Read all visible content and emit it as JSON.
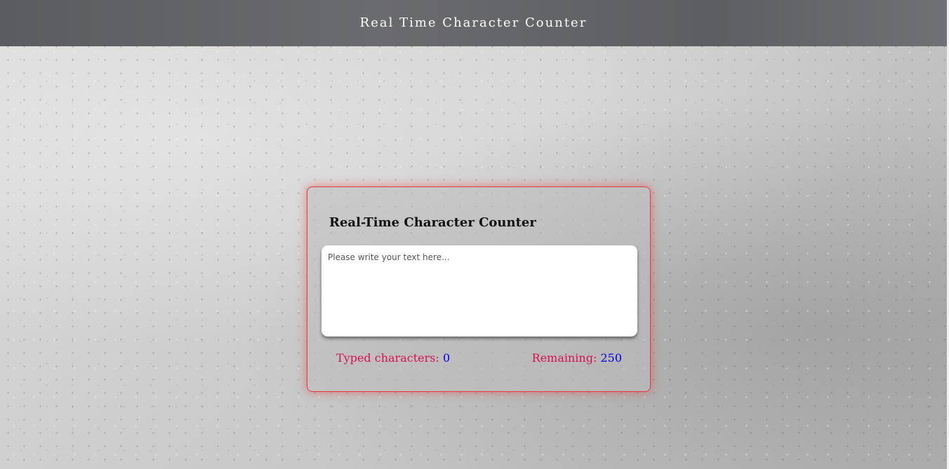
{
  "header": {
    "title": "Real Time Character Counter"
  },
  "card": {
    "title": "Real-Time Character Counter",
    "textarea": {
      "placeholder": "Please write your text here...",
      "value": ""
    },
    "typed": {
      "label": "Typed characters:",
      "value": "0"
    },
    "remaining": {
      "label": "Remaining:",
      "value": "250"
    }
  },
  "colors": {
    "header_bg": "#636467",
    "card_border": "#e23b3b",
    "label_text": "#d4134f",
    "value_text": "#0000e6"
  }
}
